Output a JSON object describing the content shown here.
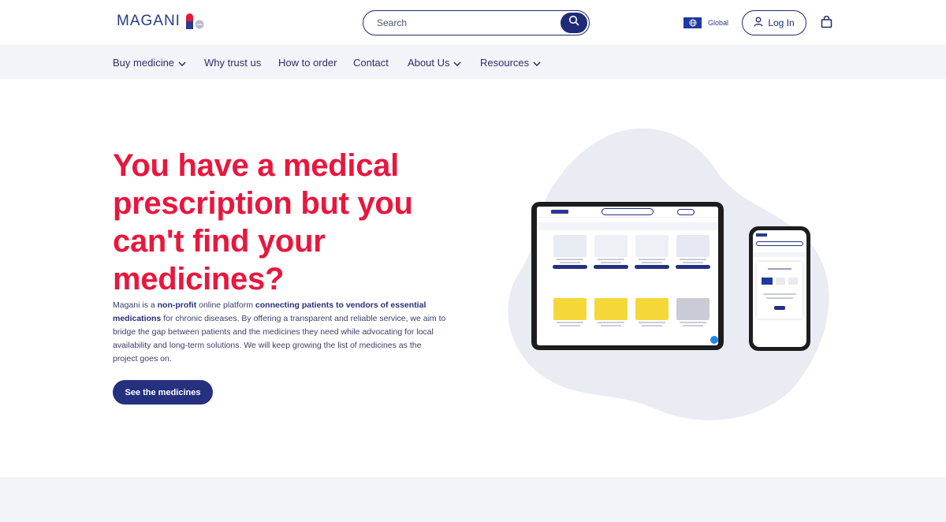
{
  "header": {
    "logo_text": "MAGANI",
    "search_placeholder": "Search",
    "region_label": "Global",
    "login_label": "Log In"
  },
  "nav": {
    "items": [
      {
        "label": "Buy medicine",
        "has_dropdown": true
      },
      {
        "label": "Why trust us",
        "has_dropdown": false
      },
      {
        "label": "How to order",
        "has_dropdown": false
      },
      {
        "label": "Contact",
        "has_dropdown": false
      },
      {
        "label": "About Us",
        "has_dropdown": true
      },
      {
        "label": "Resources",
        "has_dropdown": true
      }
    ]
  },
  "hero": {
    "title": "You have a medical prescription but you can't find your medicines?",
    "text_parts": [
      "Magani is a ",
      "non-profit",
      " online platform ",
      "connecting patients to vendors of essential medications",
      " for chronic diseases. By offering a transparent and reliable service, we aim to bridge the gap between patients and the medicines they need while advocating for local availability and long-term solutions. We will keep growing the list of medicines as the project goes on."
    ],
    "cta_label": "See the medicines"
  },
  "colors": {
    "brand_navy": "#25307f",
    "accent_red": "#e8173e",
    "nav_bg": "#f3f4f9",
    "blob": "#eaecf3"
  },
  "icons": [
    "pill-logo-icon",
    "search-icon",
    "globe-icon",
    "user-icon",
    "bag-icon",
    "chevron-down-icon"
  ]
}
